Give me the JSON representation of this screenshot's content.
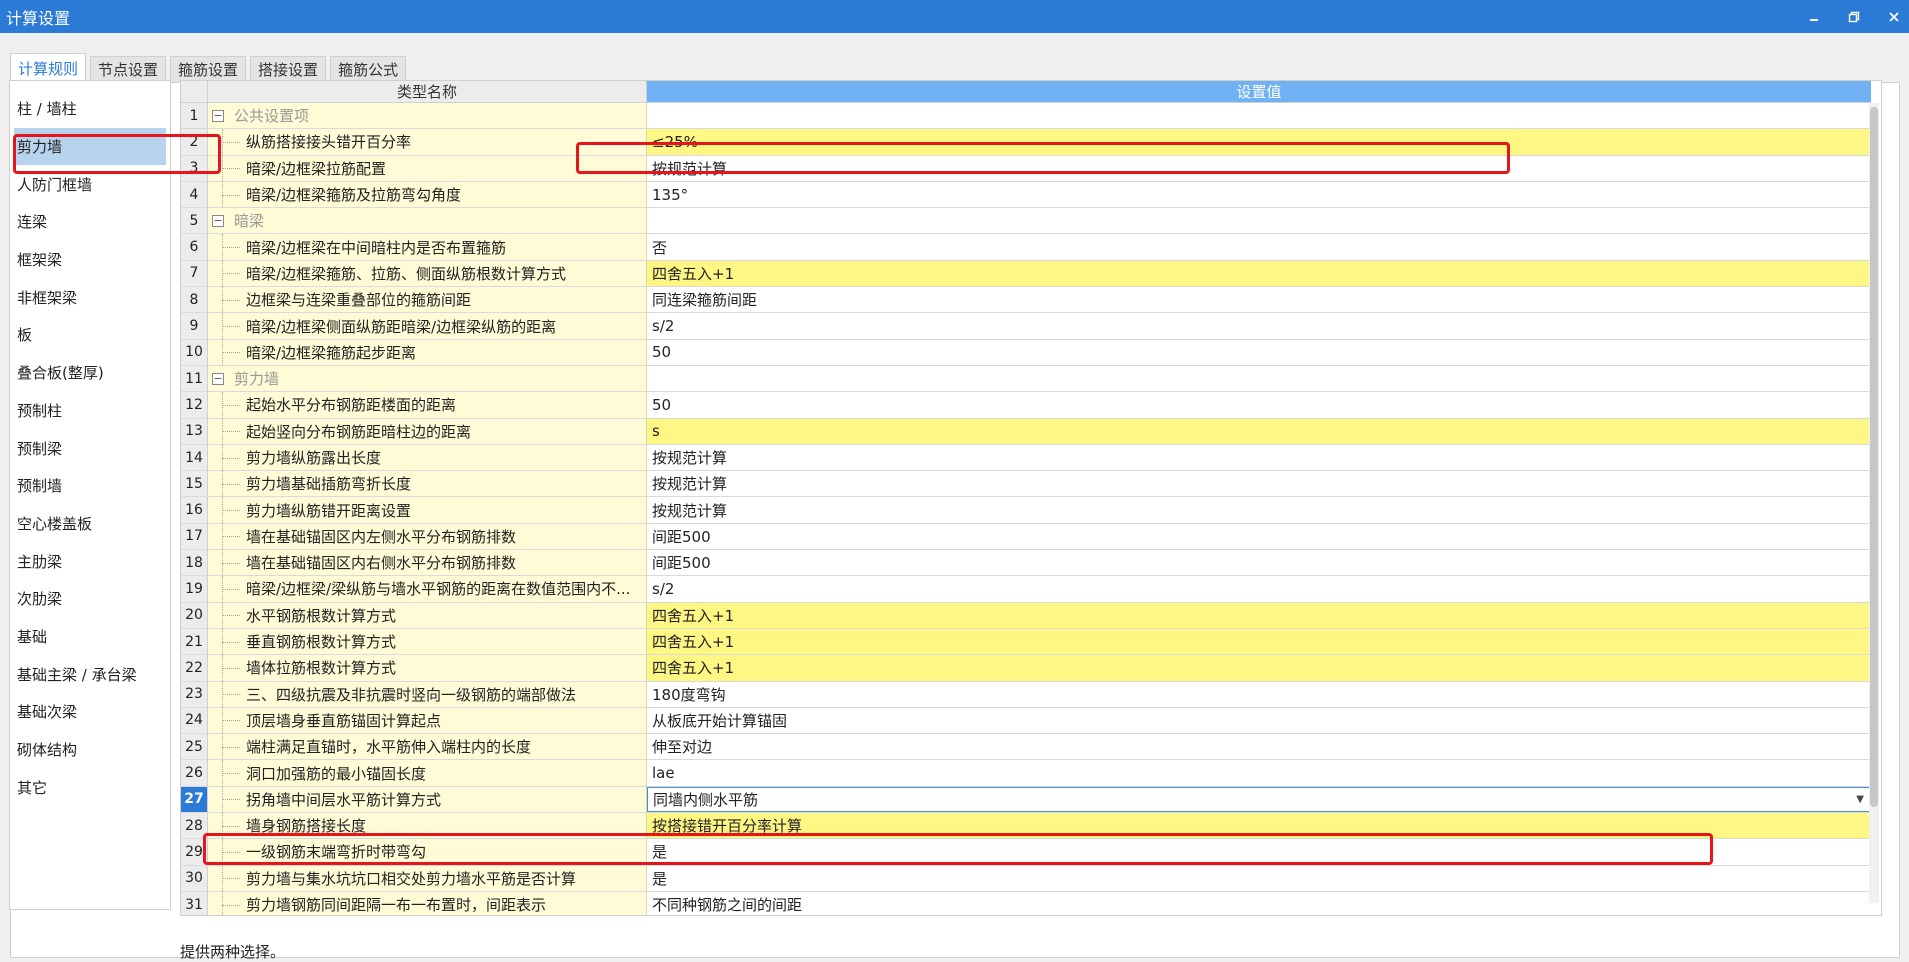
{
  "window": {
    "title": "计算设置",
    "controls": [
      "minimize-icon",
      "restore-icon",
      "close-icon"
    ],
    "accent": "#2b7ad6"
  },
  "tabs": [
    {
      "label": "计算规则",
      "active": true
    },
    {
      "label": "节点设置",
      "active": false
    },
    {
      "label": "箍筋设置",
      "active": false
    },
    {
      "label": "搭接设置",
      "active": false
    },
    {
      "label": "箍筋公式",
      "active": false
    }
  ],
  "sidebar": {
    "items": [
      {
        "label": "柱 / 墙柱"
      },
      {
        "label": "剪力墙",
        "selected": true
      },
      {
        "label": "人防门框墙"
      },
      {
        "label": "连梁"
      },
      {
        "label": "框架梁"
      },
      {
        "label": "非框架梁"
      },
      {
        "label": "板"
      },
      {
        "label": "叠合板(整厚)"
      },
      {
        "label": "预制柱"
      },
      {
        "label": "预制梁"
      },
      {
        "label": "预制墙"
      },
      {
        "label": "空心楼盖板"
      },
      {
        "label": "主肋梁"
      },
      {
        "label": "次肋梁"
      },
      {
        "label": "基础"
      },
      {
        "label": "基础主梁 / 承台梁"
      },
      {
        "label": "基础次梁"
      },
      {
        "label": "砌体结构"
      },
      {
        "label": "其它"
      }
    ]
  },
  "grid": {
    "header_name": "类型名称",
    "header_value": "设置值",
    "rows": [
      {
        "num": "1",
        "name": "公共设置项",
        "value": "",
        "group": true
      },
      {
        "num": "2",
        "name": "纵筋搭接接头错开百分率",
        "value": "≤25%",
        "yellow": true
      },
      {
        "num": "3",
        "name": "暗梁/边框梁拉筋配置",
        "value": "按规范计算"
      },
      {
        "num": "4",
        "name": "暗梁/边框梁箍筋及拉筋弯勾角度",
        "value": "135°"
      },
      {
        "num": "5",
        "name": "暗梁",
        "value": "",
        "group": true
      },
      {
        "num": "6",
        "name": "暗梁/边框梁在中间暗柱内是否布置箍筋",
        "value": "否"
      },
      {
        "num": "7",
        "name": "暗梁/边框梁箍筋、拉筋、侧面纵筋根数计算方式",
        "value": "四舍五入+1",
        "yellow": true
      },
      {
        "num": "8",
        "name": "边框梁与连梁重叠部位的箍筋间距",
        "value": "同连梁箍筋间距"
      },
      {
        "num": "9",
        "name": "暗梁/边框梁侧面纵筋距暗梁/边框梁纵筋的距离",
        "value": "s/2"
      },
      {
        "num": "10",
        "name": "暗梁/边框梁箍筋起步距离",
        "value": "50"
      },
      {
        "num": "11",
        "name": "剪力墙",
        "value": "",
        "group": true
      },
      {
        "num": "12",
        "name": "起始水平分布钢筋距楼面的距离",
        "value": "50"
      },
      {
        "num": "13",
        "name": "起始竖向分布钢筋距暗柱边的距离",
        "value": "s",
        "yellow": true
      },
      {
        "num": "14",
        "name": "剪力墙纵筋露出长度",
        "value": "按规范计算"
      },
      {
        "num": "15",
        "name": "剪力墙基础插筋弯折长度",
        "value": "按规范计算"
      },
      {
        "num": "16",
        "name": "剪力墙纵筋错开距离设置",
        "value": "按规范计算"
      },
      {
        "num": "17",
        "name": "墙在基础锚固区内左侧水平分布钢筋排数",
        "value": "间距500"
      },
      {
        "num": "18",
        "name": "墙在基础锚固区内右侧水平分布钢筋排数",
        "value": "间距500"
      },
      {
        "num": "19",
        "name": "暗梁/边框梁/梁纵筋与墙水平钢筋的距离在数值范围内不...",
        "value": "s/2"
      },
      {
        "num": "20",
        "name": "水平钢筋根数计算方式",
        "value": "四舍五入+1",
        "yellow": true
      },
      {
        "num": "21",
        "name": "垂直钢筋根数计算方式",
        "value": "四舍五入+1",
        "yellow": true
      },
      {
        "num": "22",
        "name": "墙体拉筋根数计算方式",
        "value": "四舍五入+1",
        "yellow": true
      },
      {
        "num": "23",
        "name": "三、四级抗震及非抗震时竖向一级钢筋的端部做法",
        "value": "180度弯钩"
      },
      {
        "num": "24",
        "name": "顶层墙身垂直筋锚固计算起点",
        "value": "从板底开始计算锚固"
      },
      {
        "num": "25",
        "name": "端柱满足直锚时，水平筋伸入端柱内的长度",
        "value": "伸至对边"
      },
      {
        "num": "26",
        "name": "洞口加强筋的最小锚固长度",
        "value": "lae"
      },
      {
        "num": "27",
        "name": "拐角墙中间层水平筋计算方式",
        "value": "同墙内侧水平筋",
        "current": true
      },
      {
        "num": "28",
        "name": "墙身钢筋搭接长度",
        "value": "按搭接错开百分率计算",
        "yellow": true
      },
      {
        "num": "29",
        "name": "一级钢筋末端弯折时带弯勾",
        "value": "是"
      },
      {
        "num": "30",
        "name": "剪力墙与集水坑坑口相交处剪力墙水平筋是否计算",
        "value": "是"
      },
      {
        "num": "31",
        "name": "剪力墙钢筋同间距隔一布一布置时，间距表示",
        "value": "不同种钢筋之间的间距"
      }
    ]
  },
  "hint": "提供两种选择。",
  "colors": {
    "highlight_box": "#e8141c",
    "value_yellow": "#fff784",
    "name_cream": "#fffbd6",
    "header_blue": "#6fb1f2"
  }
}
